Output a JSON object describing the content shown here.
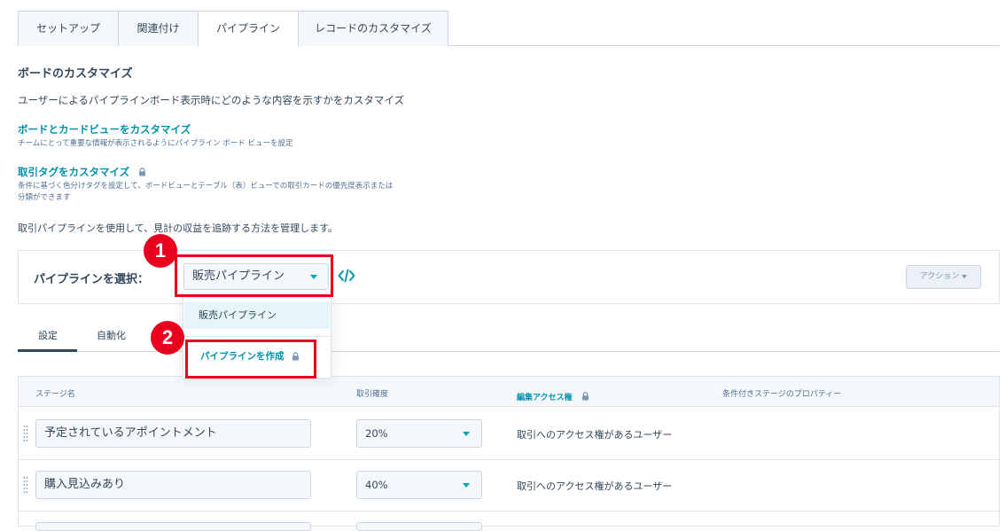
{
  "top_tabs": [
    {
      "label": "セットアップ"
    },
    {
      "label": "関連付け"
    },
    {
      "label": "パイプライン"
    },
    {
      "label": "レコードのカスタマイズ"
    }
  ],
  "board": {
    "title": "ボードのカスタマイズ",
    "description": "ユーザーによるパイプラインボード表示時にどのような内容を示すかをカスタマイズ",
    "link1": "ボードとカードビューをカスタマイズ",
    "link1_sub": "チームにとって重要な情報が表示されるようにパイプライン ボード ビューを設定",
    "link2": "取引タグをカスタマイズ",
    "link2_sub_line1": "条件に基づく色分けタグを設定して、ボードビューとテーブル（表）ビューでの取引カードの優先度表示または",
    "link2_sub_line2": "分類ができます"
  },
  "intro": "取引パイプラインを使用して、見計の収益を追跡する方法を管理します。",
  "pipeline": {
    "label": "パイプラインを選択：",
    "selected": "販売パイプライン",
    "actions_label": "アクション"
  },
  "dropdown": {
    "item": "販売パイプライン",
    "create": "パイプラインを作成"
  },
  "sub_tabs": [
    {
      "label": "設定"
    },
    {
      "label": "自動化"
    }
  ],
  "table": {
    "headers": {
      "stage": "ステージ名",
      "probability": "取引確度",
      "edit_access": "編集アクセス権",
      "conditional": "条件付きステージのプロパティー"
    },
    "rows": [
      {
        "stage": "予定されているアポイントメント",
        "probability": "20%",
        "access": "取引へのアクセス権があるユーザー"
      },
      {
        "stage": "購入見込みあり",
        "probability": "40%",
        "access": "取引へのアクセス権があるユーザー"
      }
    ]
  },
  "annotations": {
    "badge1": "1",
    "badge2": "2"
  },
  "colors": {
    "accent": "#0091ae",
    "highlight": "#e8001e",
    "text": "#33475b"
  }
}
